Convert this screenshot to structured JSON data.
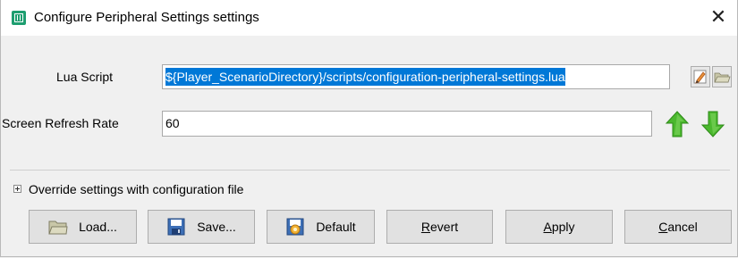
{
  "window": {
    "title": "Configure Peripheral Settings settings",
    "title_icon": "app-window-icon",
    "close_glyph": "✕"
  },
  "lua_script": {
    "label": "Lua Script",
    "value": "${Player_ScenarioDirectory}/scripts/configuration-peripheral-settings.lua",
    "edit_icon": "pencil-edit-icon",
    "browse_icon": "folder-open-icon"
  },
  "refresh_rate": {
    "label": "Screen Refresh Rate",
    "value": "60",
    "up_icon": "green-up-arrow-icon",
    "down_icon": "green-down-arrow-icon"
  },
  "override": {
    "label": "Override settings with configuration file",
    "expander_icon": "plus-expander-icon"
  },
  "buttons": {
    "load": {
      "label": "Load...",
      "icon": "folder-icon"
    },
    "save": {
      "label": "Save...",
      "icon": "floppy-disk-icon"
    },
    "default": {
      "label": "Default",
      "icon": "default-settings-icon"
    },
    "revert": {
      "label": "Revert",
      "mnemonic": "R",
      "rest": "evert"
    },
    "apply": {
      "label": "Apply",
      "mnemonic": "A",
      "rest": "pply"
    },
    "cancel": {
      "label": "Cancel",
      "mnemonic": "C",
      "rest": "ancel"
    }
  },
  "colors": {
    "selection": "#0078d7",
    "arrow_green": "#4bb82e",
    "window_bg": "#f0f0f0",
    "title_icon": "#1e9e70"
  }
}
